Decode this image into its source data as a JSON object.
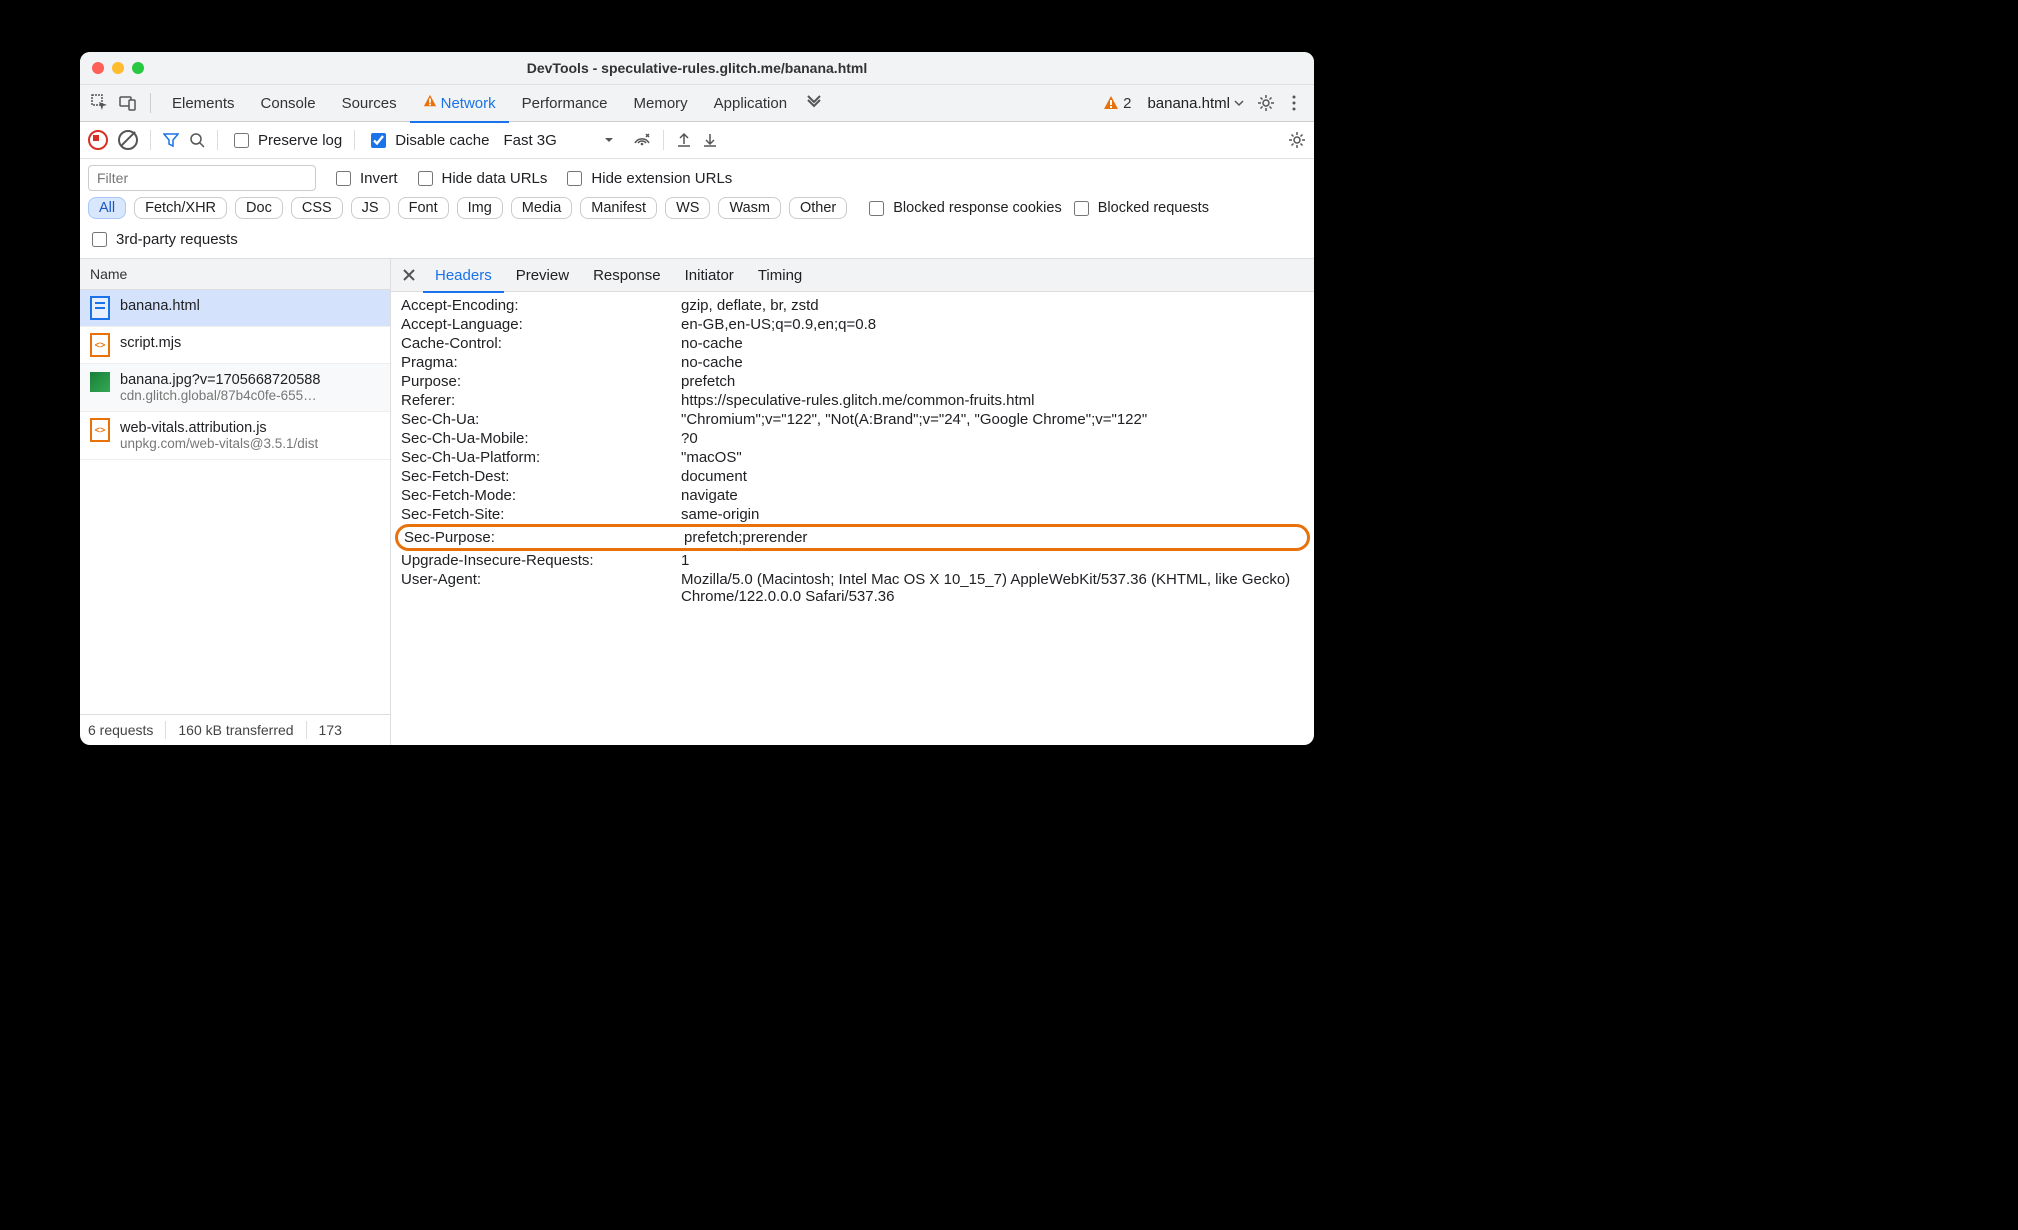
{
  "window": {
    "title": "DevTools - speculative-rules.glitch.me/banana.html"
  },
  "tabs": {
    "items": [
      "Elements",
      "Console",
      "Sources",
      "Network",
      "Performance",
      "Memory",
      "Application"
    ],
    "active": "Network",
    "warn_count": "2",
    "context": "banana.html"
  },
  "toolbar": {
    "preserve_log": "Preserve log",
    "disable_cache": "Disable cache",
    "throttle": "Fast 3G"
  },
  "filter": {
    "placeholder": "Filter",
    "invert": "Invert",
    "hide_data": "Hide data URLs",
    "hide_ext": "Hide extension URLs"
  },
  "chips": [
    "All",
    "Fetch/XHR",
    "Doc",
    "CSS",
    "JS",
    "Font",
    "Img",
    "Media",
    "Manifest",
    "WS",
    "Wasm",
    "Other"
  ],
  "chip_active": "All",
  "chip_checks": {
    "blocked_cookies": "Blocked response cookies",
    "blocked_req": "Blocked requests"
  },
  "third_party": "3rd-party requests",
  "list_head": "Name",
  "requests": [
    {
      "name": "banana.html",
      "sub": "",
      "type": "doc"
    },
    {
      "name": "script.mjs",
      "sub": "",
      "type": "js"
    },
    {
      "name": "banana.jpg?v=1705668720588",
      "sub": "cdn.glitch.global/87b4c0fe-655…",
      "type": "img"
    },
    {
      "name": "web-vitals.attribution.js",
      "sub": "unpkg.com/web-vitals@3.5.1/dist",
      "type": "js"
    }
  ],
  "footer": {
    "reqs": "6 requests",
    "transferred": "160 kB transferred",
    "more": "173"
  },
  "detail_tabs": [
    "Headers",
    "Preview",
    "Response",
    "Initiator",
    "Timing"
  ],
  "detail_active": "Headers",
  "headers": [
    {
      "k": "Accept-Encoding:",
      "v": "gzip, deflate, br, zstd"
    },
    {
      "k": "Accept-Language:",
      "v": "en-GB,en-US;q=0.9,en;q=0.8"
    },
    {
      "k": "Cache-Control:",
      "v": "no-cache"
    },
    {
      "k": "Pragma:",
      "v": "no-cache"
    },
    {
      "k": "Purpose:",
      "v": "prefetch"
    },
    {
      "k": "Referer:",
      "v": "https://speculative-rules.glitch.me/common-fruits.html"
    },
    {
      "k": "Sec-Ch-Ua:",
      "v": "\"Chromium\";v=\"122\", \"Not(A:Brand\";v=\"24\", \"Google Chrome\";v=\"122\""
    },
    {
      "k": "Sec-Ch-Ua-Mobile:",
      "v": "?0"
    },
    {
      "k": "Sec-Ch-Ua-Platform:",
      "v": "\"macOS\""
    },
    {
      "k": "Sec-Fetch-Dest:",
      "v": "document"
    },
    {
      "k": "Sec-Fetch-Mode:",
      "v": "navigate"
    },
    {
      "k": "Sec-Fetch-Site:",
      "v": "same-origin"
    },
    {
      "k": "Sec-Purpose:",
      "v": "prefetch;prerender",
      "hl": true
    },
    {
      "k": "Upgrade-Insecure-Requests:",
      "v": "1"
    },
    {
      "k": "User-Agent:",
      "v": "Mozilla/5.0 (Macintosh; Intel Mac OS X 10_15_7) AppleWebKit/537.36 (KHTML, like Gecko) Chrome/122.0.0.0 Safari/537.36"
    }
  ]
}
